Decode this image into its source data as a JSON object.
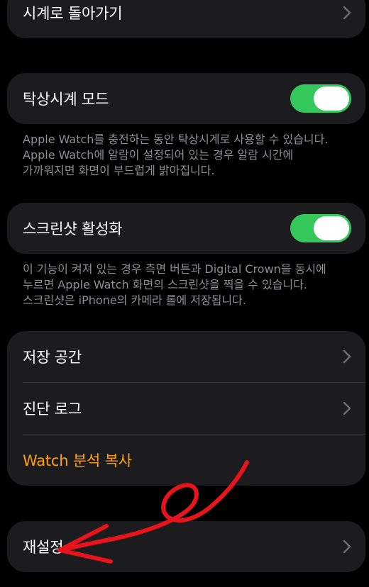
{
  "back_row": {
    "label": "시계로 돌아가기"
  },
  "nightstand": {
    "label": "탁상시계 모드",
    "enabled": true,
    "note_lines": [
      "Apple Watch를 충전하는 동안 탁상시계로 사용할 수 있습니다.",
      "Apple Watch에 알람이 설정되어 있는 경우 알람 시간에",
      "가까워지면 화면이 부드럽게 밝아집니다."
    ]
  },
  "screenshot": {
    "label": "스크린샷 활성화",
    "enabled": true,
    "note_lines": [
      "이 기능이 켜져 있는 경우 측면 버튼과 Digital Crown을 동시에",
      "누르면 Apple Watch 화면의 스크린샷을 찍을 수 있습니다.",
      "스크린샷은 iPhone의 카메라 롤에 저장됩니다."
    ]
  },
  "storage_group": {
    "storage_label": "저장 공간",
    "diagnostics_label": "진단 로그",
    "copy_analytics_label": "Watch 분석 복사"
  },
  "reset": {
    "label": "재설정"
  },
  "colors": {
    "background": "#000000",
    "card": "#1c1c1e",
    "toggle_on": "#34c759",
    "accent_orange": "#ff9f0a",
    "note_text": "#8e8e93",
    "annotation": "#e8141b"
  }
}
